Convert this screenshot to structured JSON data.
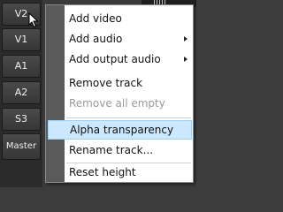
{
  "tracks": [
    {
      "label": "V2"
    },
    {
      "label": "V1"
    },
    {
      "label": "A1"
    },
    {
      "label": "A2"
    },
    {
      "label": "S3"
    },
    {
      "label": "Master"
    }
  ],
  "menu": {
    "items": [
      {
        "label": "Add video",
        "submenu": false,
        "disabled": false
      },
      {
        "label": "Add audio",
        "submenu": true,
        "disabled": false
      },
      {
        "label": "Add output audio",
        "submenu": true,
        "disabled": false
      },
      {
        "label": "Remove track",
        "submenu": false,
        "disabled": false
      },
      {
        "label": "Remove all empty",
        "submenu": false,
        "disabled": true
      },
      {
        "label": "Alpha transparency",
        "submenu": false,
        "disabled": false,
        "highlighted": true
      },
      {
        "label": "Rename track...",
        "submenu": false,
        "disabled": false
      },
      {
        "label": "Reset height",
        "submenu": false,
        "disabled": false
      }
    ]
  },
  "colors": {
    "highlight_bg": "#cce8ff",
    "highlight_border": "#99d1ff",
    "disabled_text": "#9a9a9a",
    "gutter": "#5a5a5a"
  },
  "icons": {
    "cursor": "mouse-pointer-icon",
    "submenu": "chevron-right-icon"
  }
}
